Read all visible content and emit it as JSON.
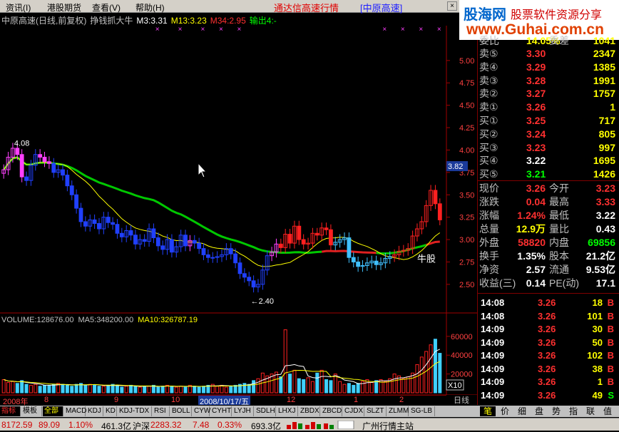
{
  "menu": {
    "items": [
      "资讯(I)",
      "港股期货",
      "查看(V)",
      "帮助(H)"
    ],
    "title": "通达信高速行情",
    "title_sub": "[中原高速]",
    "close": "×"
  },
  "logo": {
    "brand": "股海网",
    "tagline": "股票软件资源分享",
    "url": "www.Guhai.com.cn"
  },
  "chart": {
    "stock_title": "中原高速(日线,前复权)",
    "formula_name": "挣钱抓大牛",
    "indicators": [
      {
        "label": "M3:3.31",
        "color": "#ffffff"
      },
      {
        "label": "M13:3.23",
        "color": "#ffff00"
      },
      {
        "label": "M34:2.95",
        "color": "#ff3030"
      },
      {
        "label": "输出4:-",
        "color": "#00ff00"
      }
    ],
    "price_axis": [
      "5.00",
      "4.75",
      "4.50",
      "4.25",
      "4.00",
      "3.75",
      "3.50",
      "3.25",
      "3.00",
      "2.75",
      "2.50"
    ],
    "current_price_tag": "3.82",
    "high_marker": "4.08",
    "low_marker": "←2.40",
    "annotation": "牛股",
    "volume_head": {
      "volume": "VOLUME:128676.00",
      "ma5": "MA5:348200.00",
      "ma10": "MA10:326787.19"
    },
    "volume_axis": [
      "60000",
      "40000",
      "20000"
    ],
    "volume_unit": "X10",
    "date_labels": [
      "2008年",
      "8",
      "9",
      "10",
      "12",
      "1",
      "2"
    ],
    "date_box": "2008/10/17/五",
    "period": "日线"
  },
  "chart_data": {
    "type": "candlestick",
    "price_range": [
      2.3,
      5.15
    ],
    "closes": [
      3.78,
      3.92,
      4.02,
      3.95,
      3.7,
      3.66,
      3.83,
      3.95,
      3.92,
      3.87,
      3.85,
      3.75,
      3.78,
      3.72,
      3.6,
      3.5,
      3.35,
      3.2,
      3.15,
      3.22,
      3.18,
      3.12,
      3.25,
      3.19,
      3.17,
      3.07,
      3.03,
      3.1,
      3.05,
      2.95,
      3.0,
      2.98,
      3.12,
      3.02,
      2.93,
      2.89,
      3.0,
      2.86,
      2.92,
      3.05,
      2.93,
      2.99,
      2.96,
      2.9,
      2.83,
      2.8,
      2.8,
      2.81,
      2.83,
      2.9,
      2.84,
      2.74,
      2.62,
      2.58,
      2.54,
      2.47,
      2.5,
      2.66,
      2.82,
      2.86,
      2.95,
      2.91,
      3.06,
      2.96,
      3.15,
      3.0,
      2.95,
      2.96,
      3.07,
      3.05,
      3.13,
      3.11,
      2.94,
      2.97,
      3.0,
      3.02,
      2.8,
      2.75,
      2.7,
      2.71,
      2.74,
      2.76,
      2.72,
      2.74,
      2.79,
      2.81,
      2.83,
      2.87,
      2.88,
      2.9,
      3.04,
      3.12,
      3.2,
      3.38,
      3.55,
      3.4,
      3.22
    ],
    "volumes": [
      14,
      11,
      12,
      10,
      13,
      9,
      8,
      9,
      7,
      8,
      8,
      9,
      10,
      9,
      8,
      7,
      9,
      10,
      8,
      9,
      8,
      7,
      7,
      8,
      9,
      8,
      6,
      7,
      8,
      7,
      6,
      7,
      7,
      8,
      6,
      7,
      8,
      7,
      6,
      7,
      6,
      8,
      7,
      6,
      7,
      8,
      9,
      7,
      8,
      6,
      7,
      8,
      9,
      10,
      9,
      13,
      15,
      21,
      18,
      20,
      22,
      17,
      67,
      20,
      24,
      15,
      14,
      16,
      12,
      21,
      24,
      14,
      13,
      20,
      12,
      9,
      10,
      8,
      10,
      12,
      14,
      11,
      13,
      14,
      12,
      15,
      20,
      18,
      15,
      17,
      21,
      30,
      38,
      44,
      51,
      57,
      42,
      36,
      30,
      22,
      17,
      14,
      10
    ],
    "volume_range": [
      0,
      72
    ]
  },
  "orderbook": {
    "top_row": {
      "label": "委比",
      "val": "14.05%",
      "label2": "委差",
      "val2": "1041"
    },
    "sell": [
      {
        "k": "卖⑤",
        "p": "3.30",
        "q": "2347"
      },
      {
        "k": "卖④",
        "p": "3.29",
        "q": "1385"
      },
      {
        "k": "卖③",
        "p": "3.28",
        "q": "1991"
      },
      {
        "k": "卖②",
        "p": "3.27",
        "q": "1757"
      },
      {
        "k": "卖①",
        "p": "3.26",
        "q": "1"
      }
    ],
    "buy": [
      {
        "k": "买①",
        "p": "3.25",
        "q": "717"
      },
      {
        "k": "买②",
        "p": "3.24",
        "q": "805"
      },
      {
        "k": "买③",
        "p": "3.23",
        "q": "997"
      },
      {
        "k": "买④",
        "p": "3.22",
        "q": "1695"
      },
      {
        "k": "买⑤",
        "p": "3.21",
        "q": "1426"
      }
    ]
  },
  "quote": [
    {
      "a": "现价",
      "b": "3.26",
      "bc": "#ff3030",
      "c": "今开",
      "d": "3.23",
      "dc": "#ff3030"
    },
    {
      "a": "涨跌",
      "b": "0.04",
      "bc": "#ff3030",
      "c": "最高",
      "d": "3.33",
      "dc": "#ff3030"
    },
    {
      "a": "涨幅",
      "b": "1.24%",
      "bc": "#ff3030",
      "c": "最低",
      "d": "3.22",
      "dc": "#ffffff"
    },
    {
      "a": "总量",
      "b": "12.9万",
      "bc": "#ffff00",
      "c": "量比",
      "d": "0.43",
      "dc": "#ffffff"
    },
    {
      "a": "外盘",
      "b": "58820",
      "bc": "#ff3030",
      "c": "内盘",
      "d": "69856",
      "dc": "#00ff00"
    },
    {
      "a": "换手",
      "b": "1.35%",
      "bc": "#ffffff",
      "c": "股本",
      "d": "21.2亿",
      "dc": "#ffffff"
    },
    {
      "a": "净资",
      "b": "2.57",
      "bc": "#ffffff",
      "c": "流通",
      "d": "9.53亿",
      "dc": "#ffffff"
    },
    {
      "a": "收益(三)",
      "b": "0.14",
      "bc": "#ffffff",
      "c": "PE(动)",
      "d": "17.1",
      "dc": "#ffffff"
    }
  ],
  "ticks": [
    {
      "t": "14:08",
      "p": "3.26",
      "v": "18",
      "s": "B",
      "sc": "#ff3030"
    },
    {
      "t": "14:08",
      "p": "3.26",
      "v": "101",
      "s": "B",
      "sc": "#ff3030"
    },
    {
      "t": "14:09",
      "p": "3.26",
      "v": "30",
      "s": "B",
      "sc": "#ff3030"
    },
    {
      "t": "14:09",
      "p": "3.26",
      "v": "50",
      "s": "B",
      "sc": "#ff3030"
    },
    {
      "t": "14:09",
      "p": "3.26",
      "v": "102",
      "s": "B",
      "sc": "#ff3030"
    },
    {
      "t": "14:09",
      "p": "3.26",
      "v": "38",
      "s": "B",
      "sc": "#ff3030"
    },
    {
      "t": "14:09",
      "p": "3.26",
      "v": "1",
      "s": "B",
      "sc": "#ff3030"
    },
    {
      "t": "14:09",
      "p": "3.26",
      "v": "49",
      "s": "S",
      "sc": "#00ff00"
    }
  ],
  "tabs": [
    "指标",
    "模板",
    "全部",
    "MACD",
    "KDJ",
    "KD",
    "KDJ-TDX",
    "RSI",
    "BOLL",
    "CYW",
    "CYHT",
    "LYJH",
    "SDLH",
    "LHXJ",
    "ZBDX",
    "ZBCD",
    "CJDX",
    "SLZT",
    "ZLMM",
    "SG-LB"
  ],
  "side_tabs": [
    "笔",
    "价",
    "细",
    "盘",
    "势",
    "指",
    "联",
    "值"
  ],
  "status": {
    "sh_index": "8172.59",
    "sh_chg": "89.09",
    "sh_pct": "1.10%",
    "sh_amt": "461.3亿",
    "sz_name": "沪深",
    "sz_index": "2283.32",
    "sz_chg": "7.48",
    "sz_pct": "0.33%",
    "sz_amt": "693.3亿",
    "site": "广州行情主站"
  }
}
